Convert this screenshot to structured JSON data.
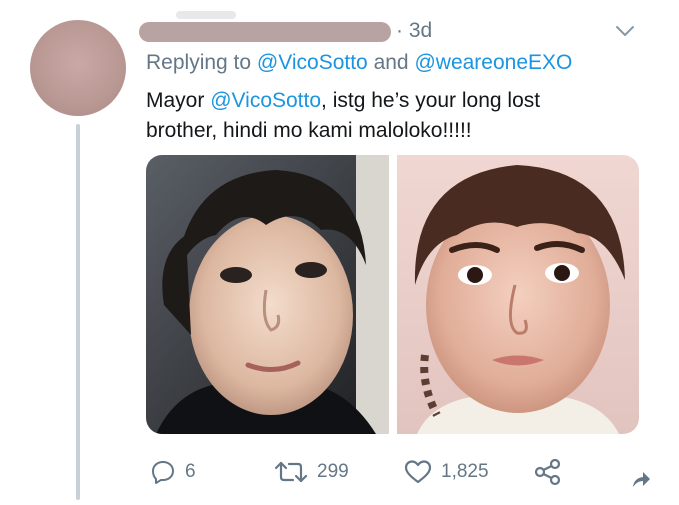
{
  "tweet": {
    "time": "· 3d",
    "reply_prefix": "Replying to",
    "reply_user1": "@VicoSotto",
    "reply_and": "and",
    "reply_user2": "@weareoneEXO",
    "text_line1_prefix": "Mayor",
    "text_mention": "@VicoSotto",
    "text_line1_suffix": ", istg he’s your long lost",
    "text_line2": "brother, hindi mo kami maloloko!!!!!"
  },
  "media": [
    {
      "icon": "photo-boy-left"
    },
    {
      "icon": "photo-boy-right"
    }
  ],
  "actions": {
    "reply_count": "6",
    "retweet_count": "299",
    "like_count": "1,825"
  },
  "colors": {
    "link": "#1b95e0",
    "muted": "#657786",
    "text": "#14171a"
  }
}
